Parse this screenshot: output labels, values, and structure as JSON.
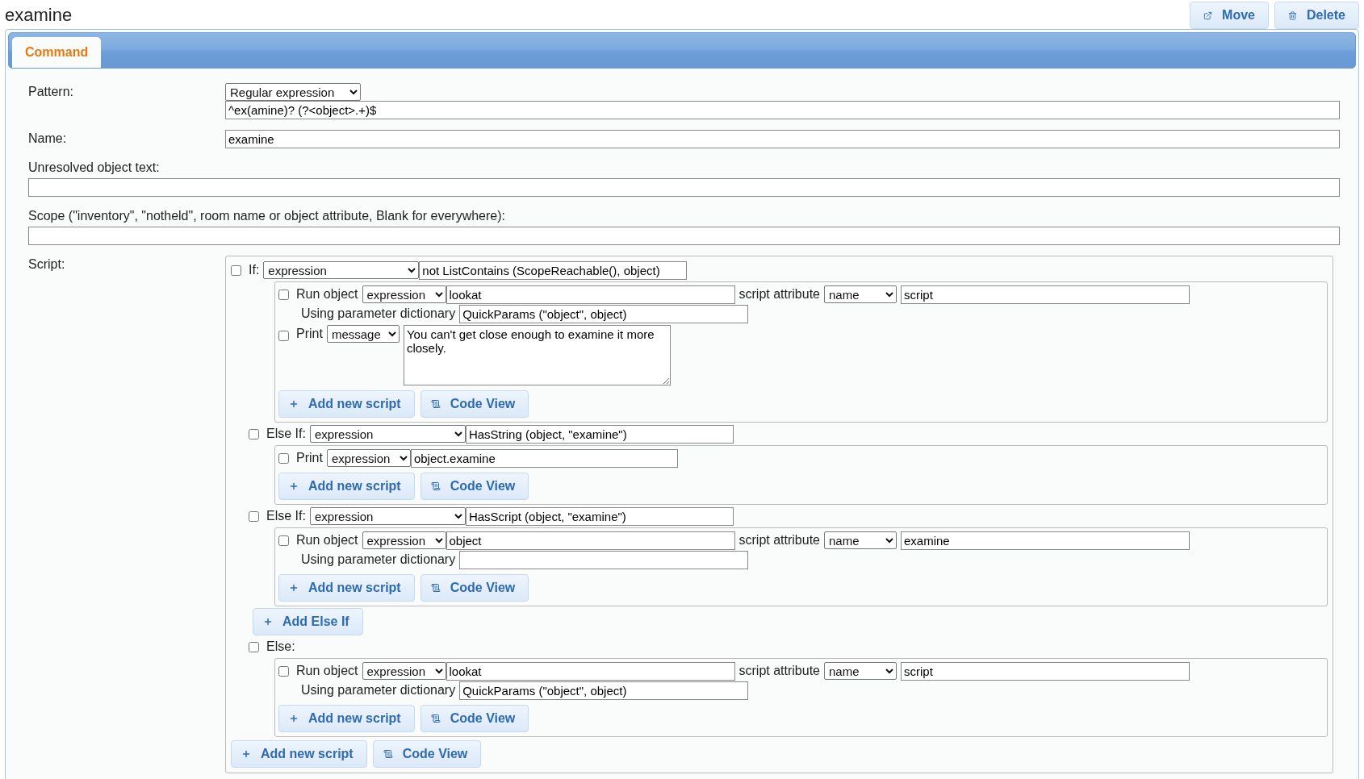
{
  "title": "examine",
  "actions": [
    {
      "kind": "move",
      "label": "Move"
    },
    {
      "kind": "delete",
      "label": "Delete"
    }
  ],
  "tabs": [
    {
      "label": "Command",
      "selected": true
    }
  ],
  "pattern": {
    "label": "Pattern:",
    "type": "Regular expression",
    "value": "^ex(amine)? (?<object>.+)$"
  },
  "name": {
    "label": "Name:",
    "value": "examine"
  },
  "unresolved": {
    "label": "Unresolved object text:"
  },
  "scope": {
    "label": "Scope (\"inventory\", \"notheld\", room name or object attribute, Blank for everywhere):"
  },
  "script": {
    "label": "Script:",
    "blocks": [
      {
        "kind": "if",
        "label": "If:",
        "checked": false,
        "mode": "expression",
        "condition": "not ListContains (ScopeReachable(), object)",
        "statements": [
          {
            "kind": "run_object",
            "checked": false,
            "label": "Run object",
            "mode": "expression",
            "object": "lookat",
            "attribute_label": "script attribute",
            "attribute_mode": "name",
            "attribute": "script",
            "params_label": "Using parameter dictionary",
            "params": "QuickParams (\"object\", object)"
          },
          {
            "kind": "print_message",
            "checked": false,
            "label": "Print",
            "mode": "message",
            "message": "You can't get close enough to examine it more closely."
          }
        ],
        "buttons": [
          {
            "kind": "add",
            "label": "Add new script"
          },
          {
            "kind": "code",
            "label": "Code View"
          }
        ]
      },
      {
        "kind": "else_if",
        "label": "Else If:",
        "checked": false,
        "mode": "expression",
        "condition": "HasString (object, \"examine\")",
        "statements": [
          {
            "kind": "print_expression",
            "checked": false,
            "label": "Print",
            "mode": "expression",
            "message": "object.examine"
          }
        ],
        "buttons": [
          {
            "kind": "add",
            "label": "Add new script"
          },
          {
            "kind": "code",
            "label": "Code View"
          }
        ]
      },
      {
        "kind": "else_if",
        "label": "Else If:",
        "checked": false,
        "mode": "expression",
        "condition": "HasScript (object, \"examine\")",
        "statements": [
          {
            "kind": "run_object",
            "checked": false,
            "label": "Run object",
            "mode": "expression",
            "object": "object",
            "attribute_label": "script attribute",
            "attribute_mode": "name",
            "attribute": "examine",
            "params_label": "Using parameter dictionary"
          }
        ],
        "buttons": [
          {
            "kind": "add",
            "label": "Add new script"
          },
          {
            "kind": "code",
            "label": "Code View"
          }
        ]
      },
      {
        "kind": "add_else_if",
        "label": "Add Else If"
      },
      {
        "kind": "else",
        "label": "Else:",
        "checked": false,
        "statements": [
          {
            "kind": "run_object",
            "checked": false,
            "label": "Run object",
            "mode": "expression",
            "object": "lookat",
            "attribute_label": "script attribute",
            "attribute_mode": "name",
            "attribute": "script",
            "params_label": "Using parameter dictionary",
            "params": "QuickParams (\"object\", object)"
          }
        ],
        "buttons": [
          {
            "kind": "add",
            "label": "Add new script"
          },
          {
            "kind": "code",
            "label": "Code View"
          }
        ]
      }
    ],
    "buttons": [
      {
        "kind": "add",
        "label": "Add new script"
      },
      {
        "kind": "code",
        "label": "Code View"
      }
    ]
  }
}
